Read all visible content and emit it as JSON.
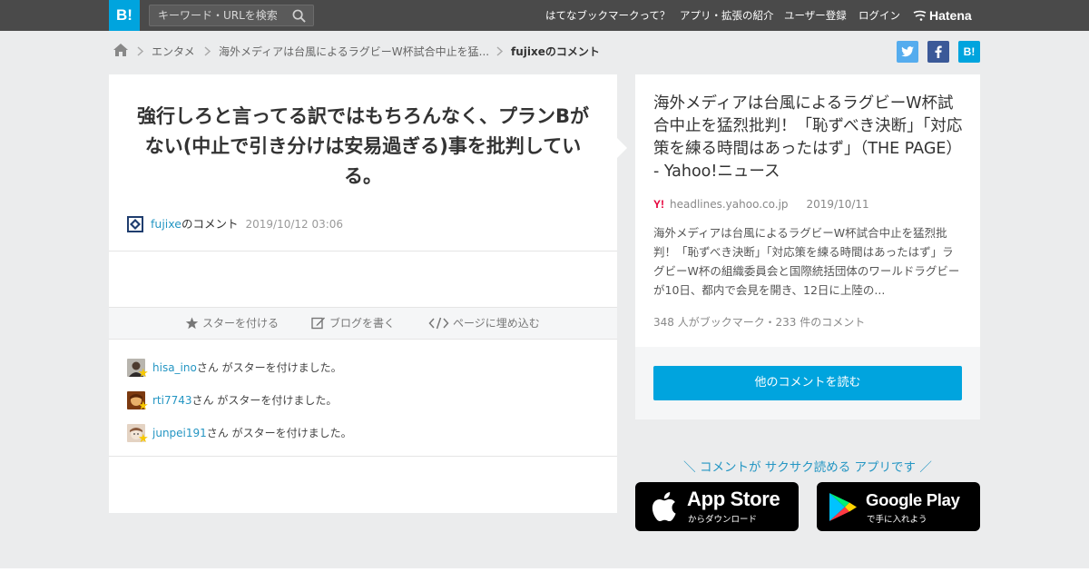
{
  "header": {
    "logo": "B!",
    "search_placeholder": "キーワード・URLを検索",
    "nav": [
      "はてなブックマークって？",
      "アプリ・拡張の紹介",
      "ユーザー登録",
      "ログイン"
    ],
    "brand": "Hatena",
    "accent": "#00a4de"
  },
  "breadcrumb": {
    "items": [
      "エンタメ",
      "海外メディアは台風によるラグビーW杯試合中止を猛..."
    ],
    "current": "fujixeのコメント"
  },
  "share": {
    "twitter": "t",
    "facebook": "f",
    "hatena": "B!"
  },
  "comment": {
    "text": "強行しろと言ってる訳ではもちろんなく、プランBがない(中止で引き分けは安易過ぎる)事を批判している。",
    "user": "fujixe",
    "suffix": "のコメント",
    "timestamp": "2019/10/12 03:06"
  },
  "actions": {
    "star": "スターを付ける",
    "blog": "ブログを書く",
    "embed": "ページに埋め込む"
  },
  "stars": [
    {
      "user": "hisa_ino",
      "text": "さん がスターを付けました。"
    },
    {
      "user": "rti7743",
      "text": "さん がスターを付けました。"
    },
    {
      "user": "junpei191",
      "text": "さん がスターを付けました。"
    }
  ],
  "entry": {
    "title": "海外メディアは台風によるラグビーW杯試合中止を猛烈批判！「恥ずべき決断」「対応策を練る時間はあったはず」（THE PAGE） - Yahoo!ニュース",
    "site_icon": "Y!",
    "site": "headlines.yahoo.co.jp",
    "date": "2019/10/11",
    "summary": "海外メディアは台風によるラグビーW杯試合中止を猛烈批判！「恥ずべき決断」「対応策を練る時間はあったはず」ラグビーW杯の組織委員会と国際統括団体のワールドラグビーが10日、都内で会見を開き、12日に上陸の...",
    "count_text": "348 人がブックマーク・233 件のコメント"
  },
  "read_more": "他のコメントを読む",
  "app_promo": "＼ コメントが サクサク読める アプリです ／",
  "app_store": {
    "main": "App Store",
    "sub": "からダウンロード"
  },
  "google_play": {
    "main": "Google Play",
    "sub": "で手に入れよう"
  }
}
